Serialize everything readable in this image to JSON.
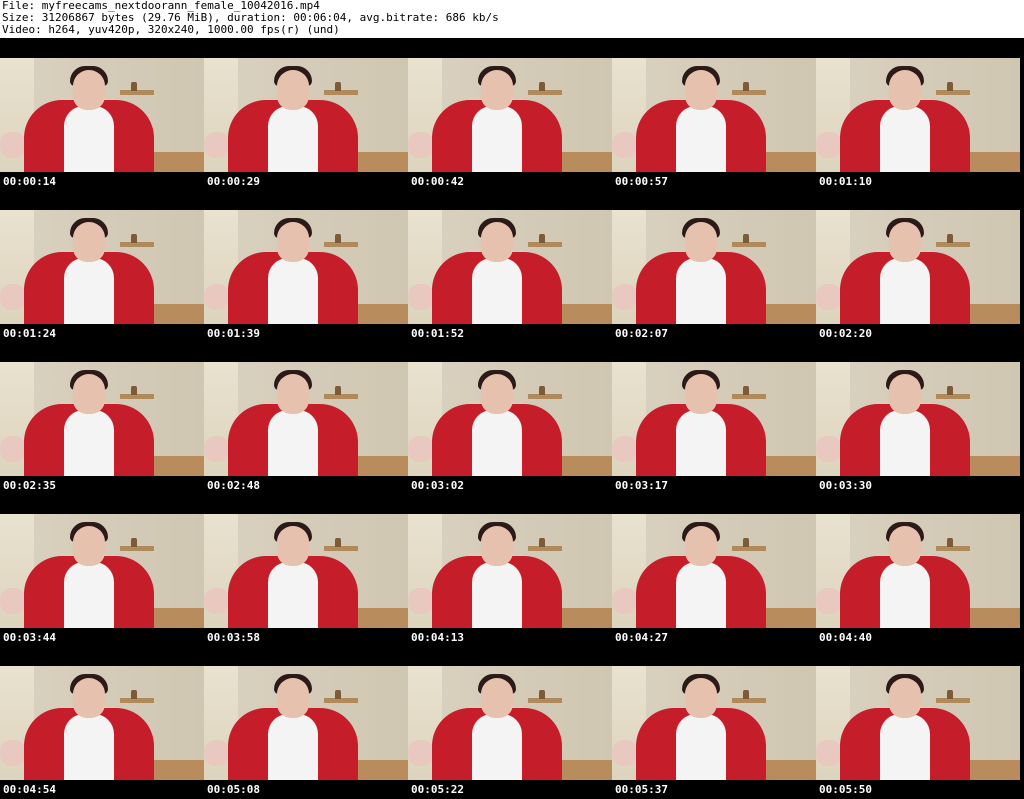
{
  "header": {
    "file": "File: myfreecams_nextdoorann_female_10042016.mp4",
    "size": "Size: 31206867 bytes (29.76 MiB), duration: 00:06:04, avg.bitrate: 686 kb/s",
    "video": "Video: h264, yuv420p, 320x240, 1000.00 fps(r) (und)"
  },
  "thumbs": [
    {
      "time": "00:00:14"
    },
    {
      "time": "00:00:29"
    },
    {
      "time": "00:00:42"
    },
    {
      "time": "00:00:57"
    },
    {
      "time": "00:01:10"
    },
    {
      "time": "00:01:24"
    },
    {
      "time": "00:01:39"
    },
    {
      "time": "00:01:52"
    },
    {
      "time": "00:02:07"
    },
    {
      "time": "00:02:20"
    },
    {
      "time": "00:02:35"
    },
    {
      "time": "00:02:48"
    },
    {
      "time": "00:03:02"
    },
    {
      "time": "00:03:17"
    },
    {
      "time": "00:03:30"
    },
    {
      "time": "00:03:44"
    },
    {
      "time": "00:03:58"
    },
    {
      "time": "00:04:13"
    },
    {
      "time": "00:04:27"
    },
    {
      "time": "00:04:40"
    },
    {
      "time": "00:04:54"
    },
    {
      "time": "00:05:08"
    },
    {
      "time": "00:05:22"
    },
    {
      "time": "00:05:37"
    },
    {
      "time": "00:05:50"
    }
  ]
}
